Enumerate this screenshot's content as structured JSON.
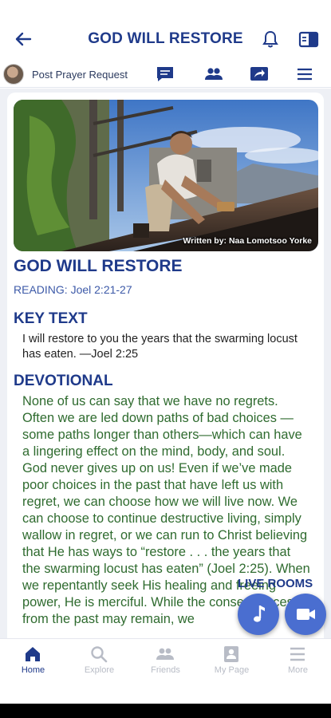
{
  "header": {
    "title": "GOD WILL RESTORE",
    "back_icon": "arrow-left-icon",
    "bell_icon": "bell-icon",
    "panel_icon": "side-panel-icon"
  },
  "subbar": {
    "post_label": "Post Prayer Request",
    "icons": [
      "chat-icon",
      "people-icon",
      "share-icon",
      "menu-icon"
    ]
  },
  "article": {
    "hero_caption": "Written by: Naa Lomotsoo Yorke",
    "title": "GOD WILL RESTORE",
    "reading": "READING: Joel 2:21-27",
    "key_heading": "KEY TEXT",
    "key_text": "I will restore to you the years that the swarming locust has eaten. —Joel 2:25",
    "devotional_heading": "DEVOTIONAL",
    "devotional_text": "None of us can say that we have no regrets. Often we are led down paths of bad choices —some paths longer than others—which can have a lingering effect on the mind, body, and soul. God never gives up on us! Even if we’ve made poor choices in the past that have left us with regret, we can choose how we will live now. We can choose to continue destructive living, simply wallow in regret, or we can run to Christ believing that He has ways to “restore . . . the years that the swarming locust has eaten” (Joel 2:25). When we repentantly seek His healing and freeing power, He is merciful. While the consequences from the past may remain, we"
  },
  "live_rooms": {
    "label": "LIVE ROOMS",
    "music_icon": "music-note-icon",
    "video_icon": "video-camera-icon"
  },
  "bottom_nav": {
    "items": [
      {
        "label": "Home",
        "icon": "home-icon",
        "active": true
      },
      {
        "label": "Explore",
        "icon": "search-icon",
        "active": false
      },
      {
        "label": "Friends",
        "icon": "friends-icon",
        "active": false
      },
      {
        "label": "My Page",
        "icon": "profile-card-icon",
        "active": false
      },
      {
        "label": "More",
        "icon": "more-menu-icon",
        "active": false
      }
    ]
  },
  "colors": {
    "brand": "#1f3a8a",
    "accent_blue": "#3d5aa8",
    "devotional_text": "#2f6b2f",
    "fab": "#4a6ed0"
  }
}
